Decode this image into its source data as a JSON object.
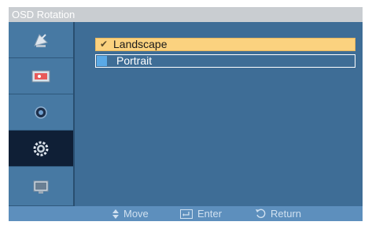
{
  "window": {
    "title": "OSD Rotation"
  },
  "sidebar": {
    "items": [
      {
        "icon": "satellite-dish-icon",
        "active": false
      },
      {
        "icon": "picture-icon",
        "active": false
      },
      {
        "icon": "sound-icon",
        "active": false
      },
      {
        "icon": "setup-gear-icon",
        "active": true
      },
      {
        "icon": "multi-control-icon",
        "active": false
      }
    ]
  },
  "menu": {
    "options": [
      {
        "label": "Landscape",
        "checked": true,
        "check_glyph": "✔"
      },
      {
        "label": "Portrait",
        "checked": false
      }
    ]
  },
  "footer": {
    "move_label": "Move",
    "enter_label": "Enter",
    "return_label": "Return"
  },
  "colors": {
    "panel": "#3e6d96",
    "active_item": "#0f1f36",
    "highlight": "#fbd27f",
    "footer": "#5d8fbd"
  }
}
